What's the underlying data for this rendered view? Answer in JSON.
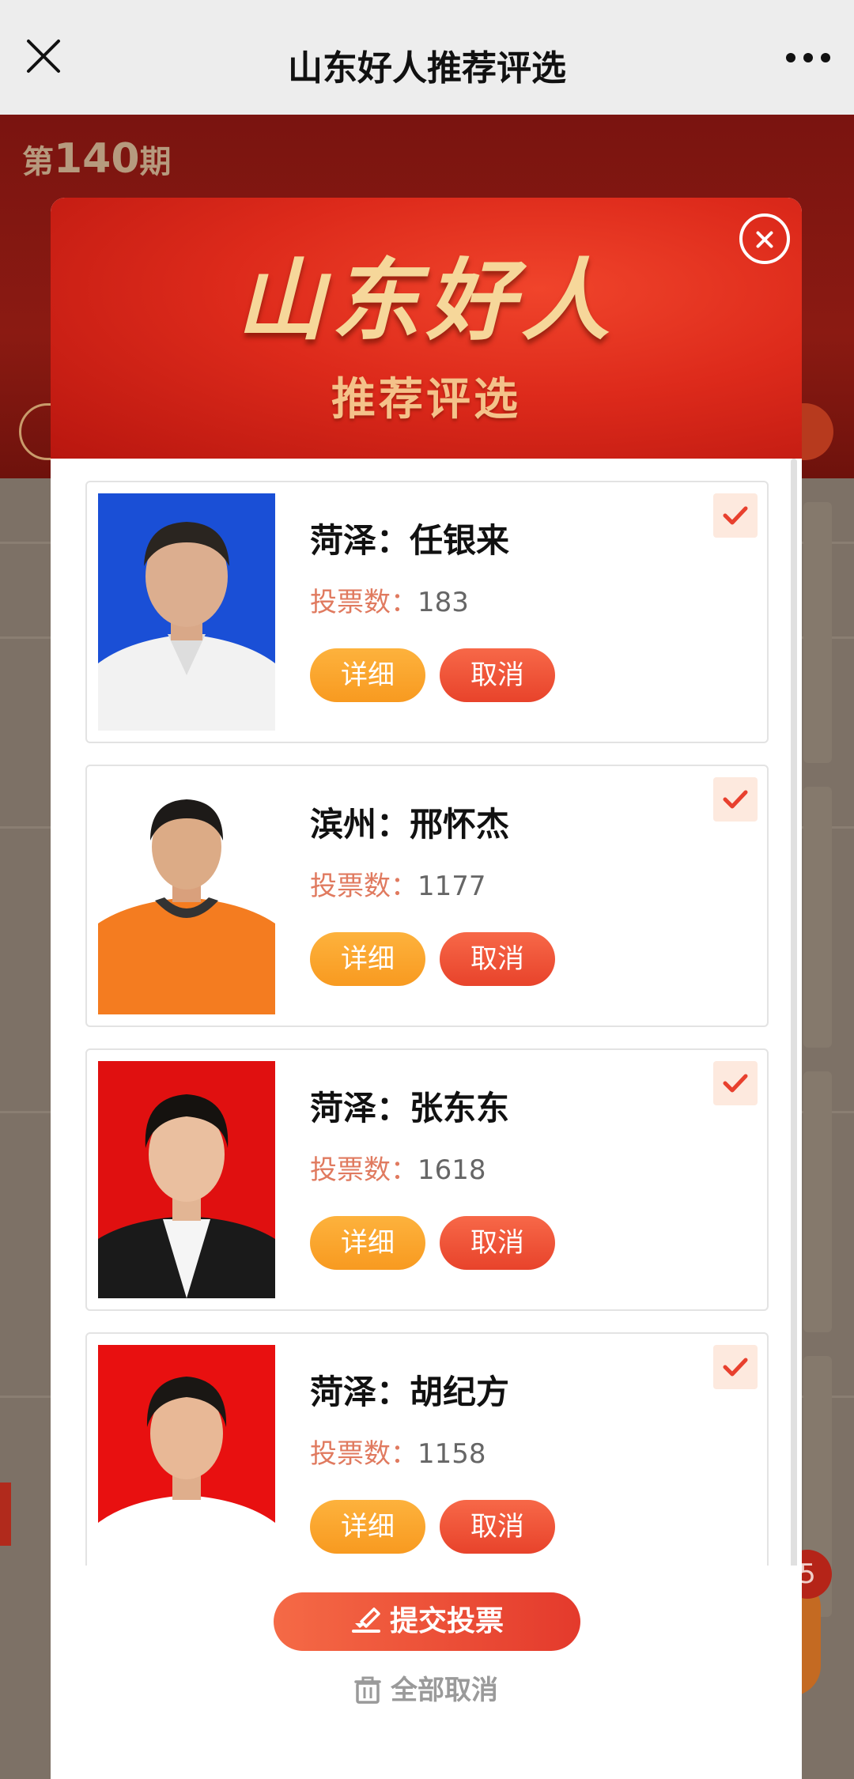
{
  "navbar": {
    "title": "山东好人推荐评选"
  },
  "background": {
    "issue_prefix": "第",
    "issue_number": "140",
    "issue_suffix": "期",
    "badge": "5"
  },
  "modal": {
    "header_title": "山东好人",
    "header_subtitle": "推荐评选",
    "candidates": [
      {
        "name": "菏泽：任银来",
        "votes_label": "投票数：",
        "votes": "183",
        "detail_label": "详细",
        "cancel_label": "取消",
        "photo_bg": "#1a4fd6",
        "shirt": "#f2f2f2"
      },
      {
        "name": "滨州：邢怀杰",
        "votes_label": "投票数：",
        "votes": "1177",
        "detail_label": "详细",
        "cancel_label": "取消",
        "photo_bg": "#ffffff",
        "shirt": "#f47c20"
      },
      {
        "name": "菏泽：张东东",
        "votes_label": "投票数：",
        "votes": "1618",
        "detail_label": "详细",
        "cancel_label": "取消",
        "photo_bg": "#e01010",
        "shirt": "#1a1a1a"
      },
      {
        "name": "菏泽：胡纪方",
        "votes_label": "投票数：",
        "votes": "1158",
        "detail_label": "详细",
        "cancel_label": "取消",
        "photo_bg": "#e81010",
        "shirt": "#ffffff"
      }
    ],
    "submit_label": "提交投票",
    "cancel_all_label": "全部取消"
  },
  "colors": {
    "accent_red": "#e8432b",
    "accent_orange": "#f89a20",
    "check_red": "#e8402e"
  }
}
